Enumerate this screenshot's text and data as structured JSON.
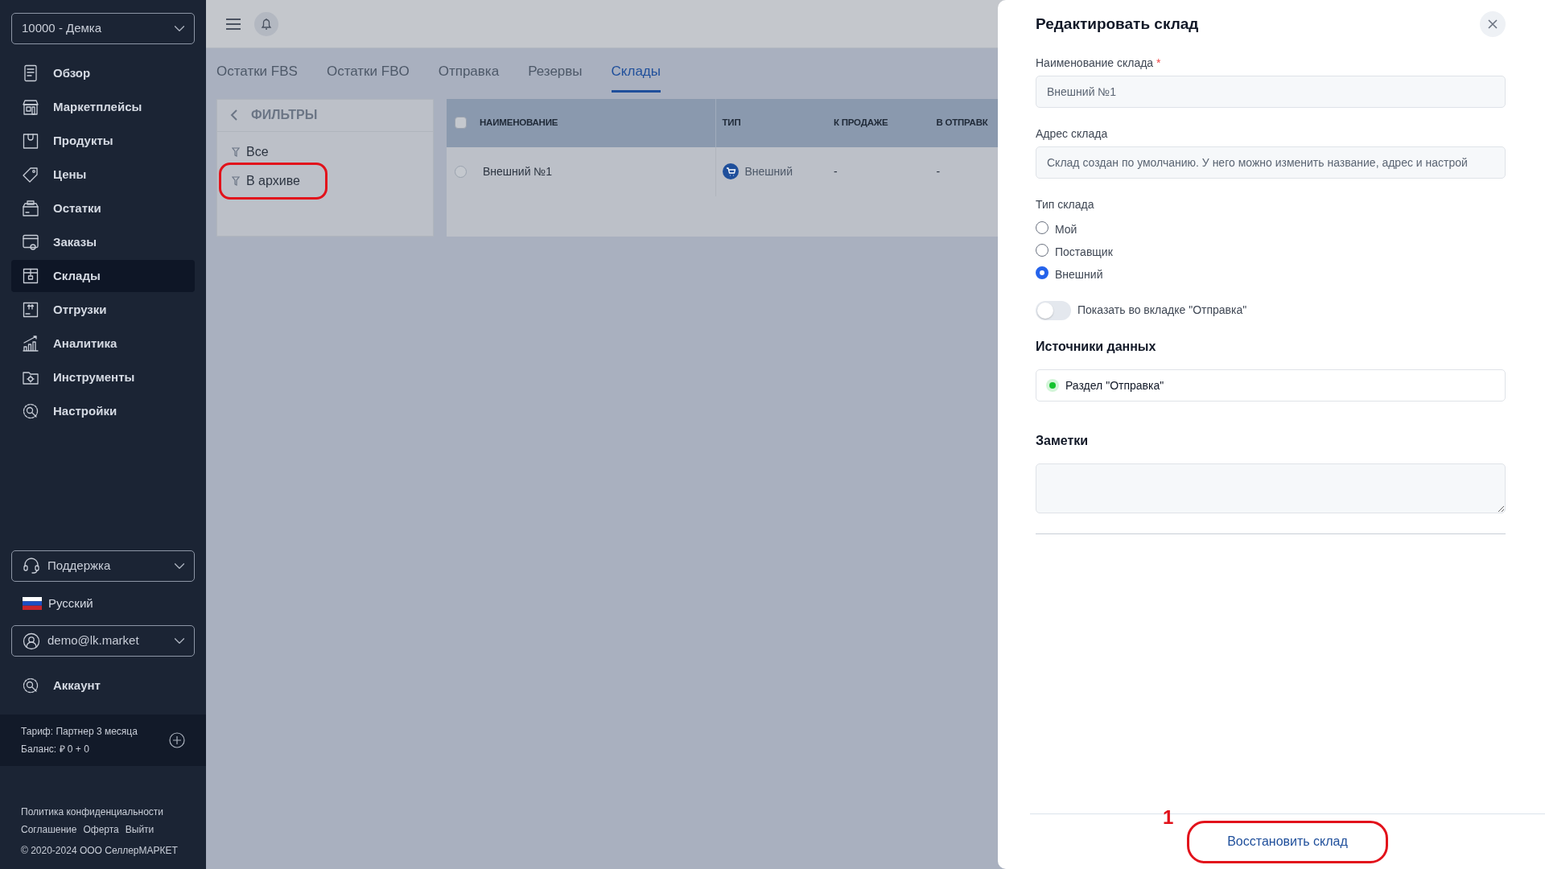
{
  "sidebar": {
    "account_select": "10000 - Демка",
    "items": [
      {
        "label": "Обзор",
        "selected": false
      },
      {
        "label": "Маркетплейсы",
        "selected": false
      },
      {
        "label": "Продукты",
        "selected": false
      },
      {
        "label": "Цены",
        "selected": false
      },
      {
        "label": "Остатки",
        "selected": false
      },
      {
        "label": "Заказы",
        "selected": false
      },
      {
        "label": "Склады",
        "selected": true
      },
      {
        "label": "Отгрузки",
        "selected": false
      },
      {
        "label": "Аналитика",
        "selected": false
      },
      {
        "label": "Инструменты",
        "selected": false
      },
      {
        "label": "Настройки",
        "selected": false
      }
    ],
    "support": "Поддержка",
    "language": "Русский",
    "user": "demo@lk.market",
    "account": "Аккаунт",
    "tariff": "Тариф: Партнер 3 месяца",
    "balance": "Баланс: ₽ 0 + 0",
    "footer_links": [
      "Политика конфиденциальности",
      "Соглашение",
      "Оферта",
      "Выйти"
    ],
    "copyright": "© 2020-2024 ООО СеллерМАРКЕТ"
  },
  "tabs": [
    {
      "label": "Остатки FBS",
      "selected": false
    },
    {
      "label": "Остатки FBO",
      "selected": false
    },
    {
      "label": "Отправка",
      "selected": false
    },
    {
      "label": "Резервы",
      "selected": false
    },
    {
      "label": "Склады",
      "selected": true
    }
  ],
  "filters": {
    "title": "ФИЛЬТРЫ",
    "items": [
      {
        "label": "Все",
        "circled": false
      },
      {
        "label": "В архиве",
        "circled": true
      }
    ]
  },
  "table": {
    "columns": [
      "НАИМЕНОВАНИЕ",
      "ТИП",
      "К ПРОДАЖЕ",
      "В ОТПРАВК"
    ],
    "header_checked": false,
    "rows": [
      {
        "checked": false,
        "cells": [
          "Внешний №1",
          "Внешний",
          "-",
          "-"
        ]
      }
    ]
  },
  "panel": {
    "title": "Редактировать склад",
    "name_label": "Наименование склада",
    "required_mark": "*",
    "name_value": "Внешний №1",
    "address_label": "Адрес склада",
    "address_value": "Склад создан по умолчанию. У него можно изменить название, адрес и настрой",
    "type_label": "Тип склада",
    "types": [
      {
        "label": "Мой",
        "selected": false
      },
      {
        "label": "Поставщик",
        "selected": false
      },
      {
        "label": "Внешний",
        "selected": true
      }
    ],
    "toggle": {
      "label": "Показать во вкладке \"Отправка\"",
      "on": false
    },
    "sources_title": "Источники данных",
    "sources": [
      {
        "label": "Раздел \"Отправка\""
      }
    ],
    "notes_title": "Заметки",
    "button": {
      "label": "Восстановить склад",
      "circled": true,
      "annotation_number": "1"
    }
  }
}
